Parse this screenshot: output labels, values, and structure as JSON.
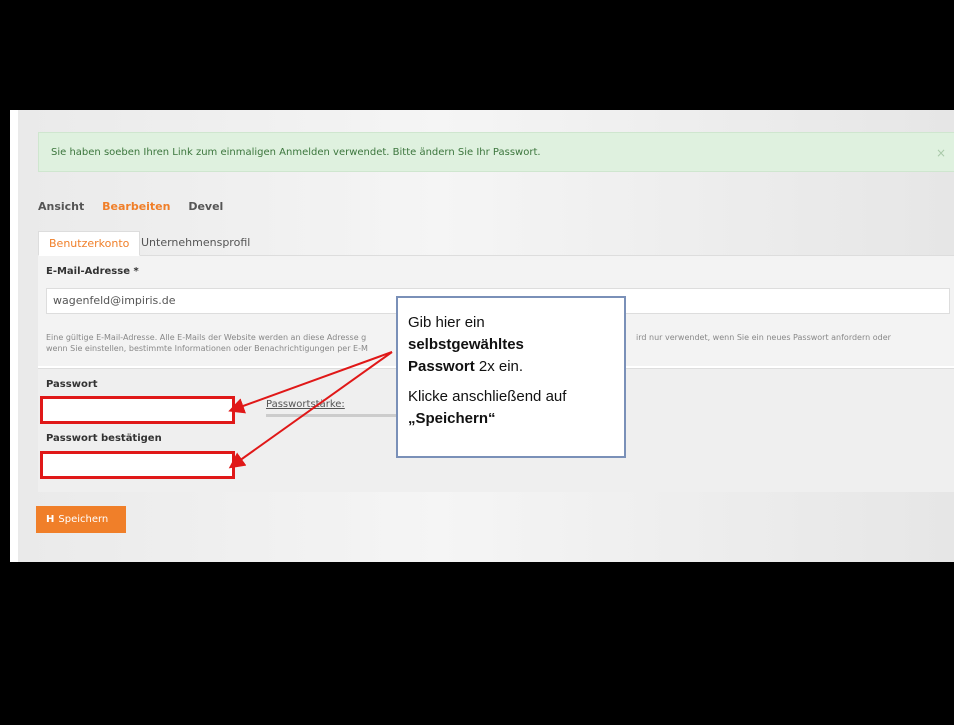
{
  "alert": {
    "message": "Sie haben soeben Ihren Link zum einmaligen Anmelden verwendet. Bitte ändern Sie Ihr Passwort.",
    "close": "×"
  },
  "primary_tabs": [
    {
      "label": "Ansicht"
    },
    {
      "label": "Bearbeiten",
      "active": true
    },
    {
      "label": "Devel"
    }
  ],
  "sub_tabs": [
    {
      "label": "Benutzerkonto",
      "active": true
    },
    {
      "label": "Unternehmensprofil"
    }
  ],
  "email": {
    "label": "E-Mail-Adresse *",
    "value": "wagenfeld@impiris.de",
    "help_line1": "Eine gültige E-Mail-Adresse. Alle E-Mails der Website werden an diese Adresse g",
    "help_line1b": "ird nur verwendet, wenn Sie ein neues Passwort anfordern oder",
    "help_line2": "wenn Sie einstellen, bestimmte Informationen oder Benachrichtigungen per E-M"
  },
  "password": {
    "label": "Passwort",
    "confirm_label": "Passwort bestätigen",
    "strength_label": "Passwortstärke:"
  },
  "save_button": {
    "label": "Speichern",
    "icon": "floppy-disk-icon"
  },
  "callout": {
    "line1": "Gib hier ein",
    "line2": "selbstgewähltes",
    "line3_bold": "Passwort",
    "line3_rest": " 2x ein.",
    "line4": "Klicke anschließend auf",
    "line5": "„Speichern“"
  },
  "colors": {
    "accent": "#f07f29",
    "highlight": "#e01818",
    "alert_bg": "#dff1df",
    "alert_text": "#3c763d"
  }
}
